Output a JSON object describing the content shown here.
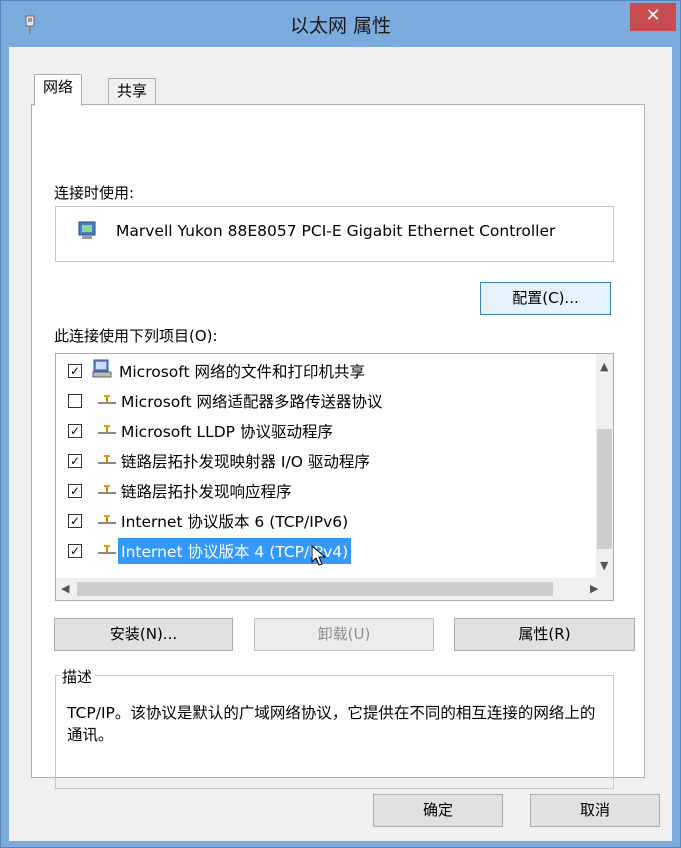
{
  "window": {
    "title": "以太网 属性",
    "close_label": "✕"
  },
  "tabs": [
    {
      "label": "网络"
    },
    {
      "label": "共享"
    }
  ],
  "connect_using": {
    "label": "连接时使用:",
    "adapter_name": "Marvell Yukon 88E8057 PCI-E Gigabit Ethernet Controller",
    "configure_label": "配置(C)..."
  },
  "items_section": {
    "label": "此连接使用下列项目(O):",
    "items": [
      {
        "checked": true,
        "label": "Microsoft 网络的文件和打印机共享",
        "icon": "printer-icon"
      },
      {
        "checked": false,
        "label": "Microsoft 网络适配器多路传送器协议",
        "icon": "protocol-icon"
      },
      {
        "checked": true,
        "label": "Microsoft LLDP 协议驱动程序",
        "icon": "protocol-icon"
      },
      {
        "checked": true,
        "label": "链路层拓扑发现映射器 I/O 驱动程序",
        "icon": "protocol-icon"
      },
      {
        "checked": true,
        "label": "链路层拓扑发现响应程序",
        "icon": "protocol-icon"
      },
      {
        "checked": true,
        "label": "Internet 协议版本 6 (TCP/IPv6)",
        "icon": "protocol-icon"
      },
      {
        "checked": true,
        "label": "Internet 协议版本 4 (TCP/IPv4)",
        "icon": "protocol-icon",
        "selected": true
      }
    ]
  },
  "actions": {
    "install_label": "安装(N)...",
    "uninstall_label": "卸载(U)",
    "properties_label": "属性(R)"
  },
  "description": {
    "title": "描述",
    "text": "TCP/IP。该协议是默认的广域网络协议，它提供在不同的相互连接的网络上的通讯。"
  },
  "footer": {
    "ok_label": "确定",
    "cancel_label": "取消"
  },
  "colors": {
    "selection": "#3399ff",
    "titlebar": "#7cacde",
    "close": "#c74b50"
  }
}
